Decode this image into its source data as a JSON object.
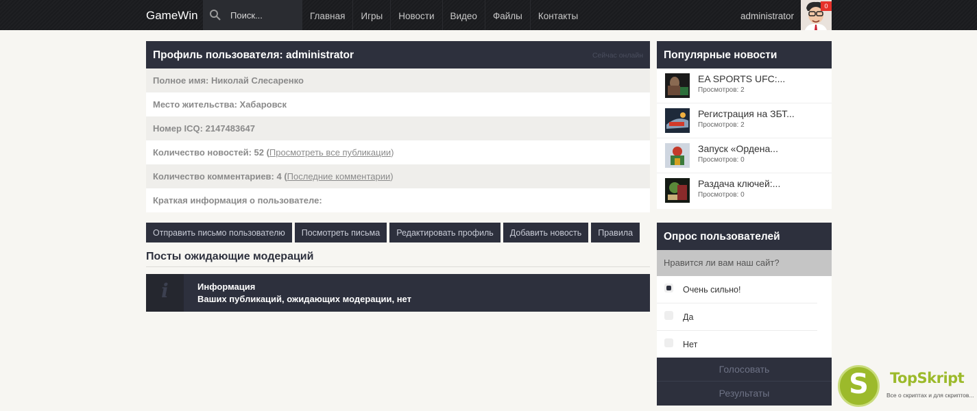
{
  "header": {
    "brand": "GameWin",
    "search_placeholder": "Поиск...",
    "nav": [
      "Главная",
      "Игры",
      "Новости",
      "Видео",
      "Файлы",
      "Контакты"
    ],
    "username": "administrator",
    "notification_count": "0"
  },
  "profile": {
    "title": "Профиль пользователя: administrator",
    "status": "Сейчас онлайн",
    "full_name_label": "Полное имя:",
    "full_name": "Николай Слесаренко",
    "location_label": "Место жительства:",
    "location": "Хабаровск",
    "icq_label": "Номер ICQ:",
    "icq": "2147483647",
    "news_label": "Количество новостей: 52 (",
    "news_link": "Просмотреть все публикации",
    "comments_label": "Количество комментариев: 4 (",
    "comments_link": "Последние комментарии",
    "close_paren": ")",
    "about_label": "Краткая информация о пользователе:"
  },
  "actions": [
    "Отправить письмо пользователю",
    "Посмотреть письма",
    "Редактировать профиль",
    "Добавить новость",
    "Правила"
  ],
  "moderation": {
    "title": "Посты ожидающие модераций",
    "info_title": "Информация",
    "info_text": "Ваших публикаций, ожидающих модерации, нет"
  },
  "popular": {
    "title": "Популярные новости",
    "items": [
      {
        "title": "EA SPORTS UFC:...",
        "views": "Просмотров: 2"
      },
      {
        "title": "Регистрация на ЗБТ...",
        "views": "Просмотров: 2"
      },
      {
        "title": "Запуск «Ордена...",
        "views": "Просмотров: 0"
      },
      {
        "title": "Раздача ключей:...",
        "views": "Просмотров: 0"
      }
    ]
  },
  "poll": {
    "title": "Опрос пользователей",
    "question": "Нравится ли вам наш сайт?",
    "options": [
      "Очень сильно!",
      "Да",
      "Нет"
    ],
    "selected_index": 0,
    "vote": "Голосовать",
    "results": "Результаты"
  },
  "watermark": {
    "letter": "S",
    "brand": "TopSkript",
    "tagline": "Все о скриптах и для скриптов..."
  },
  "colors": {
    "panel": "#2d303d",
    "background": "#f7f6f2",
    "badge": "#e6322b",
    "watermark": "#9cba2b"
  }
}
